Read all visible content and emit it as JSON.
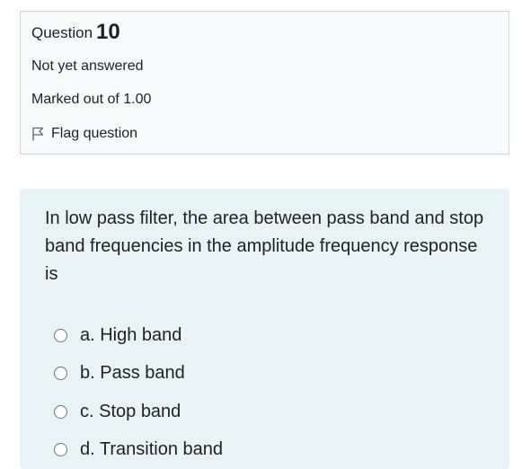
{
  "info": {
    "question_label": "Question",
    "question_number": "10",
    "status": "Not yet answered",
    "grade": "Marked out of 1.00",
    "flag_label": "Flag question",
    "flag_icon": "flag-outline-icon"
  },
  "question": {
    "text": "In low pass filter, the area between pass band and stop band frequencies in the amplitude frequency response is",
    "answers": [
      {
        "label": "a. High band"
      },
      {
        "label": "b. Pass band"
      },
      {
        "label": "c. Stop band"
      },
      {
        "label": "d. Transition band"
      }
    ]
  },
  "colors": {
    "info_bg": "#f8f9fa",
    "info_border": "#cfd2d6",
    "question_bg": "#e7f3f5",
    "text": "#1d2125"
  }
}
